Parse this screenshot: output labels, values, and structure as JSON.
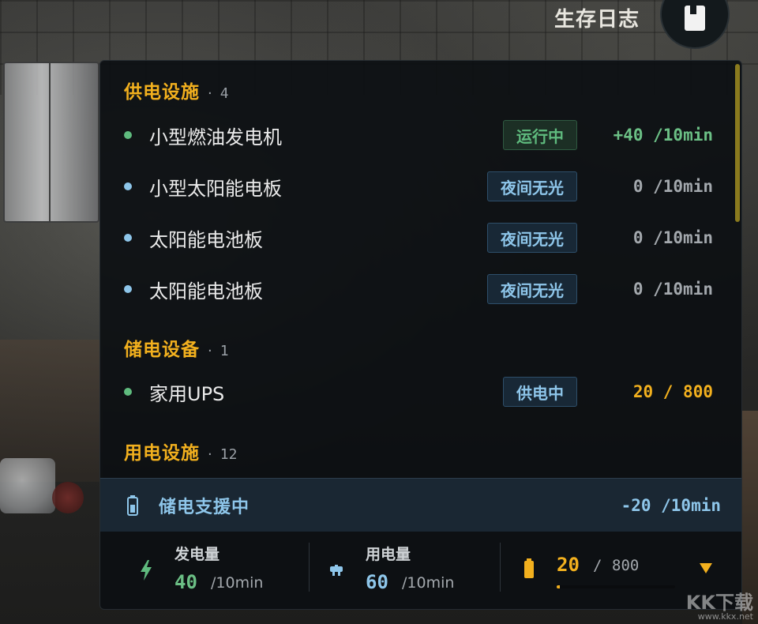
{
  "header": {
    "title": "生存日志",
    "journal_icon": "book-icon"
  },
  "sections": [
    {
      "title": "供电设施",
      "count": "4",
      "items": [
        {
          "name": "小型燃油发电机",
          "status": "运行中",
          "status_color": "green",
          "value": "+40 /10min",
          "value_color": "green",
          "dot": "#5fbb7e"
        },
        {
          "name": "小型太阳能电板",
          "status": "夜间无光",
          "status_color": "blue",
          "value": "0 /10min",
          "value_color": "gray",
          "dot": "#8ec6ea"
        },
        {
          "name": "太阳能电池板",
          "status": "夜间无光",
          "status_color": "blue",
          "value": "0 /10min",
          "value_color": "gray",
          "dot": "#8ec6ea"
        },
        {
          "name": "太阳能电池板",
          "status": "夜间无光",
          "status_color": "blue",
          "value": "0 /10min",
          "value_color": "gray",
          "dot": "#8ec6ea"
        }
      ]
    },
    {
      "title": "储电设备",
      "count": "1",
      "items": [
        {
          "name": "家用UPS",
          "status": "供电中",
          "status_color": "blue",
          "value": "20 / 800",
          "value_color": "yellow",
          "dot": "#5fbb7e"
        }
      ]
    },
    {
      "title": "用电设施",
      "count": "12",
      "items": []
    }
  ],
  "support": {
    "label": "储电支援中",
    "value": "-20 /10min",
    "icon": "battery-icon"
  },
  "stats": {
    "generation": {
      "label": "发电量",
      "value": "40",
      "unit": "/10min",
      "icon": "lightning-icon"
    },
    "consumption": {
      "label": "用电量",
      "value": "60",
      "unit": "/10min",
      "icon": "plug-icon"
    },
    "storage": {
      "value": "20",
      "separator": "/",
      "max": "800",
      "fill_fraction": 0.025,
      "icon": "battery-icon"
    }
  },
  "watermark": {
    "text": "KK下载",
    "url": "www.kkx.net"
  },
  "colors": {
    "accent": "#f2b01e",
    "positive": "#5fbb7e",
    "info": "#8ec6ea"
  }
}
